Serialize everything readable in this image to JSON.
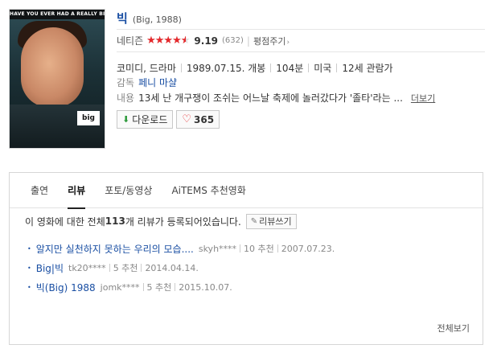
{
  "poster": {
    "banner_text": "HAVE YOU EVER HAD A REALLY BIG SECRET?",
    "title_text": "big"
  },
  "movie": {
    "title": "빅",
    "original_title": "(Big, 1988)",
    "rating_label": "네티즌",
    "rating_value": 9.19,
    "rating_score": "9.19",
    "rating_count": "(632)",
    "rate_link": "평점주기",
    "genre": "코미디, 드라마",
    "release": "1989.07.15. 개봉",
    "runtime": "104분",
    "country": "미국",
    "age_rating": "12세 관람가",
    "director_label": "감독",
    "director": "페니 마샬",
    "synopsis_label": "내용",
    "synopsis": "13세 난 개구쟁이 조쉬는 어느날 축제에 놀러갔다가 '졸타'라는 ...",
    "more_link": "더보기"
  },
  "actions": {
    "download_label": "다운로드",
    "like_count": "365"
  },
  "tabs": [
    {
      "label": "출연",
      "active": false
    },
    {
      "label": "리뷰",
      "active": true
    },
    {
      "label": "포토/동영상",
      "active": false
    },
    {
      "label": "AiTEMS 추천영화",
      "active": false
    }
  ],
  "reviews": {
    "summary_prefix": "이 영화에 대한 전체 ",
    "summary_count": "113",
    "summary_suffix": "개 리뷰가 등록되어있습니다.",
    "write_label": "리뷰쓰기",
    "items": [
      {
        "title": "알지만 실천하지 못하는 우리의 모습....",
        "author": "skyh****",
        "recommend": "10 추천",
        "date": "2007.07.23."
      },
      {
        "title": "Big|빅",
        "author": "tk20****",
        "recommend": "5 추천",
        "date": "2014.04.14."
      },
      {
        "title": "빅(Big) 1988",
        "author": "jomk****",
        "recommend": "5 추천",
        "date": "2015.10.07."
      }
    ],
    "all_link": "전체보기"
  },
  "icons": {
    "star": "star-icon",
    "download": "download-icon",
    "heart": "heart-icon",
    "pencil": "pencil-icon",
    "chevron": "chevron-right-icon"
  },
  "colors": {
    "accent_blue": "#1a4fa3",
    "star_red": "#e5292c",
    "download_green": "#2e9a3c"
  }
}
